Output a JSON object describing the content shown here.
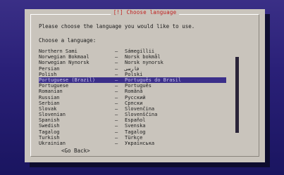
{
  "dialog": {
    "title": "[!] Choose language",
    "prompt": "Please choose the language you would like to use.",
    "list_label": "Choose a language:",
    "go_back": "<Go Back>"
  },
  "languages": [
    {
      "name": "Northern Sami",
      "native": "Sámegillii",
      "selected": false
    },
    {
      "name": "Norwegian Bokmaal",
      "native": "Norsk bokmål",
      "selected": false
    },
    {
      "name": "Norwegian Nynorsk",
      "native": "Norsk nynorsk",
      "selected": false
    },
    {
      "name": "Persian",
      "native": "فارسی",
      "selected": false
    },
    {
      "name": "Polish",
      "native": "Polski",
      "selected": false
    },
    {
      "name": "Portuguese (Brazil)",
      "native": "Português do Brasil",
      "selected": true
    },
    {
      "name": "Portuguese",
      "native": "Português",
      "selected": false
    },
    {
      "name": "Romanian",
      "native": "Română",
      "selected": false
    },
    {
      "name": "Russian",
      "native": "Русский",
      "selected": false
    },
    {
      "name": "Serbian",
      "native": "Српски",
      "selected": false
    },
    {
      "name": "Slovak",
      "native": "Slovenčina",
      "selected": false
    },
    {
      "name": "Slovenian",
      "native": "Slovenščina",
      "selected": false
    },
    {
      "name": "Spanish",
      "native": "Español",
      "selected": false
    },
    {
      "name": "Swedish",
      "native": "Svenska",
      "selected": false
    },
    {
      "name": "Tagalog",
      "native": "Tagalog",
      "selected": false
    },
    {
      "name": "Turkish",
      "native": "Türkçe",
      "selected": false
    },
    {
      "name": "Ukrainian",
      "native": "Українська",
      "selected": false
    }
  ],
  "separator": "–",
  "colors": {
    "background": "#1d1660",
    "dialog": "#c9c4bc",
    "title_text": "#c02020",
    "selection": "#3b2f8a"
  }
}
